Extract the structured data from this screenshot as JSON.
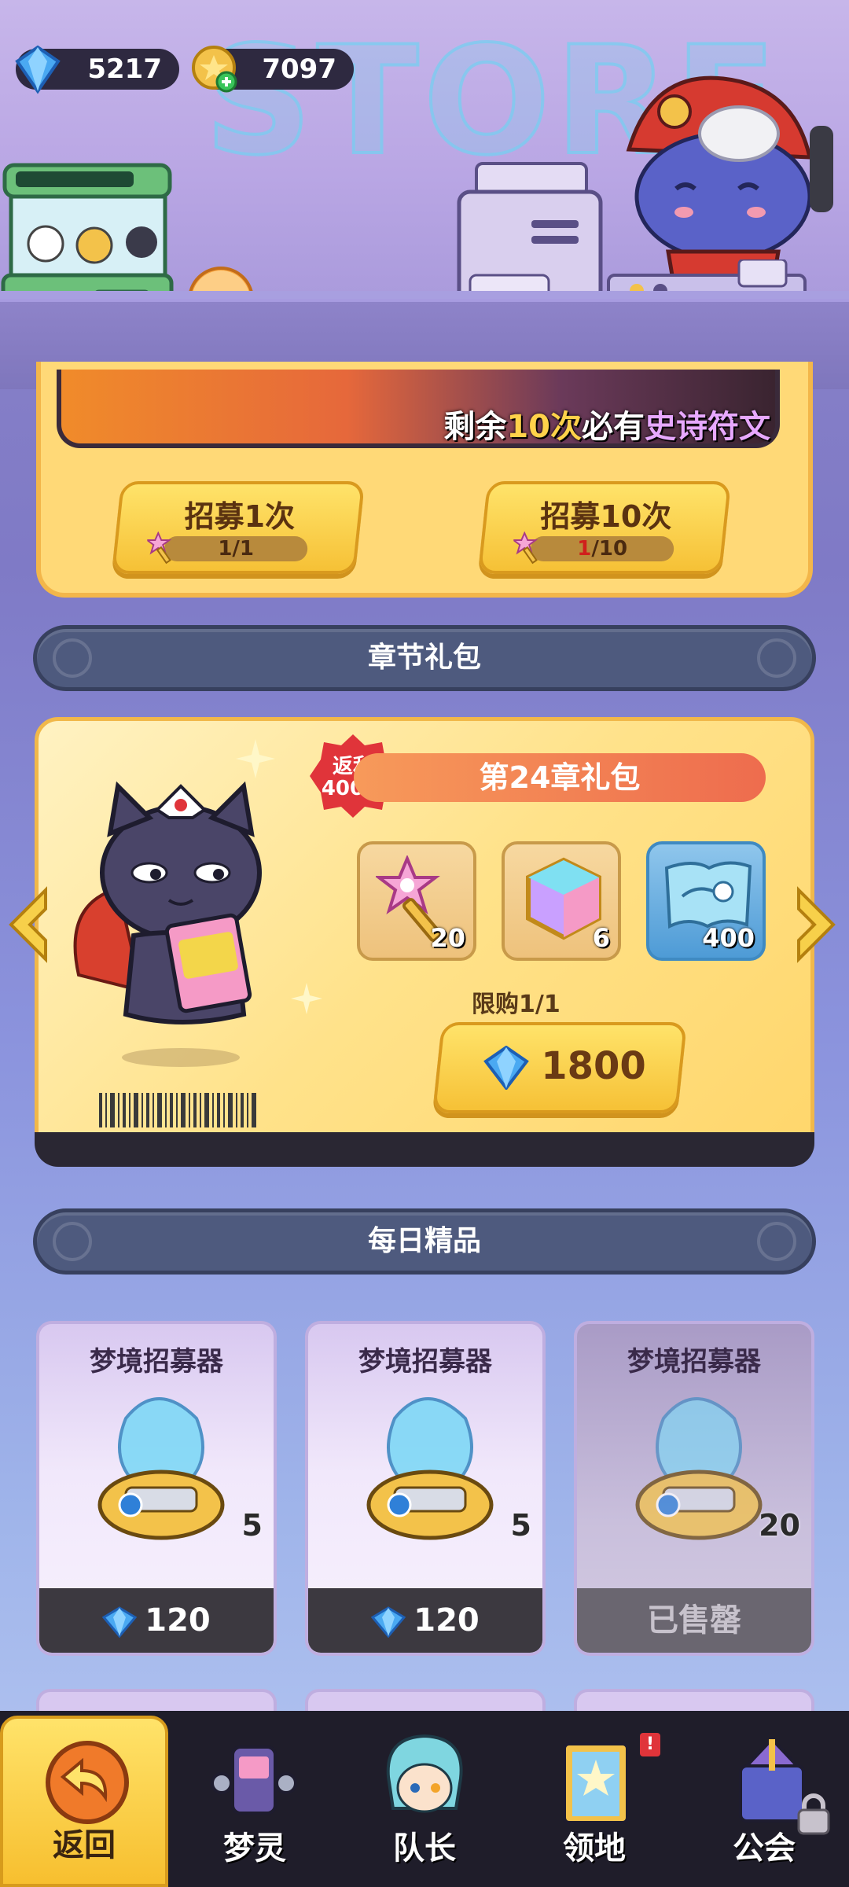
{
  "header": {
    "store_sign": "STORE",
    "gems": "5217",
    "coins": "7097"
  },
  "recruit": {
    "banner_prefix": "剩余",
    "banner_count": "10次",
    "banner_mid": "必有",
    "banner_reward": "史诗符文",
    "single_label": "招募1次",
    "single_count": "1/1",
    "ten_label": "招募10次",
    "ten_count_have": "1",
    "ten_count_need": "/10"
  },
  "chapter": {
    "section_title": "章节礼包",
    "rebate_label": "返利",
    "rebate_value": "400%",
    "pack_title": "第24章礼包",
    "items": [
      {
        "icon": "star-key-icon",
        "qty": "20"
      },
      {
        "icon": "rainbow-cube-icon",
        "qty": "6"
      },
      {
        "icon": "map-icon",
        "qty": "400"
      }
    ],
    "limit_text": "限购1/1",
    "price": "1800"
  },
  "daily": {
    "section_title": "每日精品",
    "cards": [
      {
        "name": "梦境招募器",
        "qty": "5",
        "price": "120",
        "sold": false
      },
      {
        "name": "梦境招募器",
        "qty": "5",
        "price": "120",
        "sold": false
      },
      {
        "name": "梦境招募器",
        "qty": "20",
        "price": "已售罄",
        "sold": true
      }
    ]
  },
  "nav": {
    "items": [
      {
        "label": "返回",
        "icon": "back-arrow-icon"
      },
      {
        "label": "梦灵",
        "icon": "arcade-machine-icon"
      },
      {
        "label": "队长",
        "icon": "captain-avatar-icon"
      },
      {
        "label": "领地",
        "icon": "territory-door-icon",
        "badge": "!"
      },
      {
        "label": "公会",
        "icon": "guild-ship-icon",
        "locked": true
      }
    ]
  },
  "colors": {
    "accent_yellow": "#f6c136",
    "section_bar": "#4e5a7e",
    "nav_bg": "#1f1d2a",
    "rebate_red": "#e0343a"
  }
}
